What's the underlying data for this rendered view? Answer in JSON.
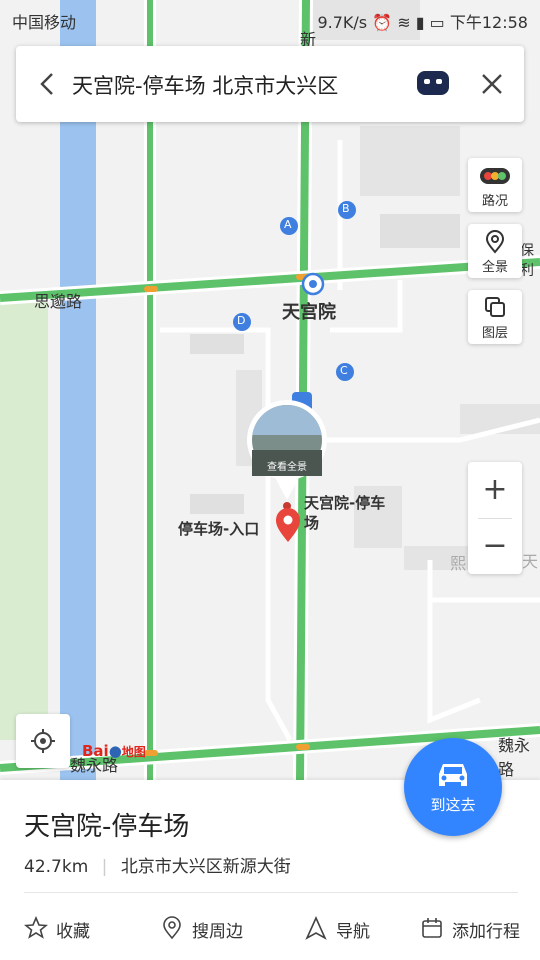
{
  "status_bar": {
    "carrier": "中国移动",
    "speed": "9.7K/s",
    "time": "下午12:58"
  },
  "search_bar": {
    "query": "天宫院-停车场 北京市大兴区"
  },
  "map_controls": {
    "traffic_label": "路况",
    "panorama_label": "全景",
    "layers_label": "图层",
    "zoom_in": "+",
    "zoom_out": "−"
  },
  "map_labels": {
    "road_north": "新",
    "road_west": "思邈路",
    "station": "天宫院",
    "exit_a": "A",
    "exit_b": "B",
    "exit_c": "C",
    "exit_d": "D",
    "poi_parking_name": "天宫院-停车",
    "poi_parking_name2": "场",
    "poi_entrance": "停车场-入口",
    "panorama_thumb_label": "查看全景",
    "road_south_east": "魏永路",
    "road_south_west": "魏永路",
    "right_edge_1": "保利",
    "right_edge_2": "天",
    "right_edge_3": "熙"
  },
  "brand": {
    "logo_text": "Bai",
    "logo_text2": "地图"
  },
  "place": {
    "name": "天宫院-停车场",
    "distance": "42.7km",
    "address": "北京市大兴区新源大街"
  },
  "actions": [
    {
      "label": "收藏"
    },
    {
      "label": "搜周边"
    },
    {
      "label": "导航"
    },
    {
      "label": "添加行程"
    }
  ],
  "go_button": {
    "label": "到这去"
  },
  "colors": {
    "accent": "#3385ff",
    "road_green": "#5ec26a",
    "river": "#8fb8e8",
    "marker_red": "#e8453c"
  }
}
